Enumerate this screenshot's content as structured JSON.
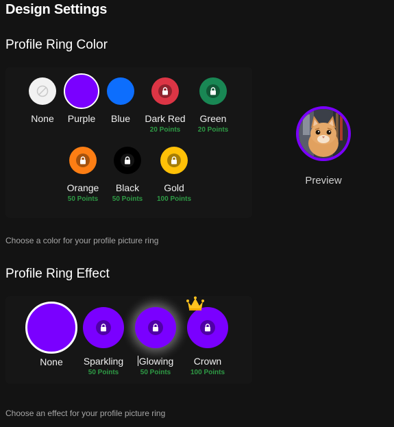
{
  "page_title": "Design Settings",
  "ring_color": {
    "title": "Profile Ring Color",
    "hint": "Choose a color for your profile picture ring",
    "options": [
      {
        "label": "None",
        "color": "#f2f2f2",
        "state": "none"
      },
      {
        "label": "Purple",
        "color": "#7a00ff",
        "state": "selected"
      },
      {
        "label": "Blue",
        "color": "#0d6efd",
        "state": "unlocked"
      },
      {
        "label": "Dark Red",
        "color": "#dc3545",
        "state": "locked",
        "points": "20 Points"
      },
      {
        "label": "Green",
        "color": "#198754",
        "state": "locked",
        "points": "20 Points"
      },
      {
        "label": "Orange",
        "color": "#fd7e14",
        "state": "locked",
        "points": "50 Points"
      },
      {
        "label": "Black",
        "color": "#000000",
        "state": "locked",
        "points": "50 Points"
      },
      {
        "label": "Gold",
        "color": "#ffc107",
        "state": "locked",
        "points": "100 Points"
      }
    ]
  },
  "preview": {
    "label": "Preview",
    "ring_color": "#7a00ff"
  },
  "ring_effect": {
    "title": "Profile Ring Effect",
    "hint": "Choose an effect for your profile picture ring",
    "options": [
      {
        "label": "None",
        "state": "selected"
      },
      {
        "label": "Sparkling",
        "state": "locked",
        "points": "50 Points"
      },
      {
        "label": "Glowing",
        "state": "locked",
        "points": "50 Points"
      },
      {
        "label": "Crown",
        "state": "locked",
        "points": "100 Points",
        "icon": "crown-icon"
      }
    ]
  },
  "colors": {
    "accent": "#7a00ff",
    "points_green": "#2e9a45",
    "background": "#131313",
    "crown_gold": "#ffc31f"
  }
}
